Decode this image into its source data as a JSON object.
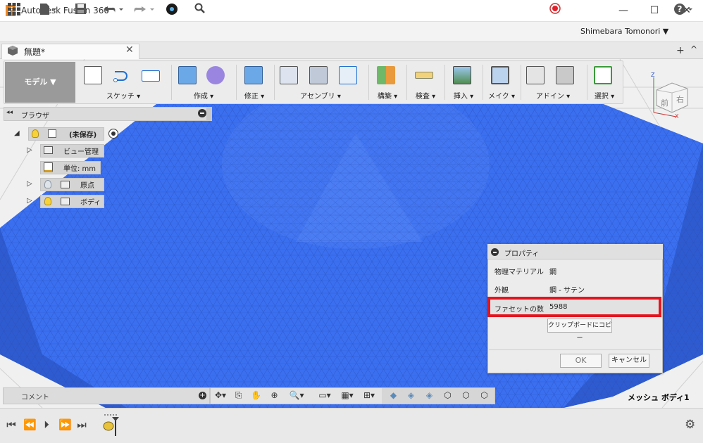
{
  "titlebar": {
    "app_title": "Autodesk Fusion 360",
    "logo_letter": "F"
  },
  "qat": {
    "user_name": "Shimebara Tomonori ▼"
  },
  "document_tab": {
    "label": "無題*"
  },
  "ribbon": {
    "workspace": "モデル ▼",
    "groups": [
      {
        "label": "スケッチ ▾"
      },
      {
        "label": "作成 ▾"
      },
      {
        "label": "修正 ▾"
      },
      {
        "label": "アセンブリ ▾"
      },
      {
        "label": "構築 ▾"
      },
      {
        "label": "検査 ▾"
      },
      {
        "label": "挿入 ▾"
      },
      {
        "label": "メイク ▾"
      },
      {
        "label": "アドイン ▾"
      },
      {
        "label": "選択 ▾"
      }
    ]
  },
  "browser": {
    "title": "ブラウザ",
    "root_label": "(未保存)",
    "items": [
      {
        "label": "ビュー管理"
      },
      {
        "label": "単位: mm"
      },
      {
        "label": "原点"
      },
      {
        "label": "ボディ"
      }
    ]
  },
  "properties": {
    "title": "プロパティ",
    "rows": [
      {
        "label": "物理マテリアル",
        "value": "鋼"
      },
      {
        "label": "外観",
        "value": "鋼 - サテン"
      },
      {
        "label": "ファセットの数",
        "value": "5988"
      }
    ],
    "copy_button": "クリップボードにコピー",
    "ok_button": "OK",
    "cancel_button": "キャンセル"
  },
  "comment": {
    "label": "コメント"
  },
  "viewport": {
    "selection_label": "メッシュ ボディ1",
    "mesh_color": "#3a6ff0"
  },
  "viewcube": {
    "front": "前",
    "right": "右"
  }
}
